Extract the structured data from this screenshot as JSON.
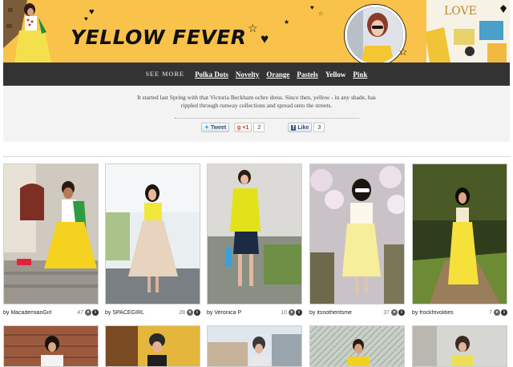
{
  "banner": {
    "title": "YELLOW FEVER",
    "bg": "#f9c24a"
  },
  "nav": {
    "see_more": "SEE MORE",
    "links": [
      "Polka Dots",
      "Novelty",
      "Orange",
      "Pastels"
    ],
    "current": "Yellow",
    "last": "Pink"
  },
  "intro": {
    "text": "It started last Spring with that Victoria Beckham ochre dress. Since then, yellow - in any shade, has rippled through runway collections and spread onto the streets.",
    "tweet_label": "Tweet",
    "gplus_label": "+1",
    "gplus_count": "2",
    "like_label": "Like",
    "like_count": "3"
  },
  "posts": [
    {
      "by": "by MacademianGirl",
      "likes": "47"
    },
    {
      "by": "by SPACEGIRL",
      "likes": "28"
    },
    {
      "by": "by Veronica P",
      "likes": "10"
    },
    {
      "by": "by itsnotheritsme",
      "likes": "37"
    },
    {
      "by": "by frockfrivolities",
      "likes": "7"
    }
  ],
  "icons": {
    "heart": "heart-icon",
    "info": "info-icon"
  }
}
